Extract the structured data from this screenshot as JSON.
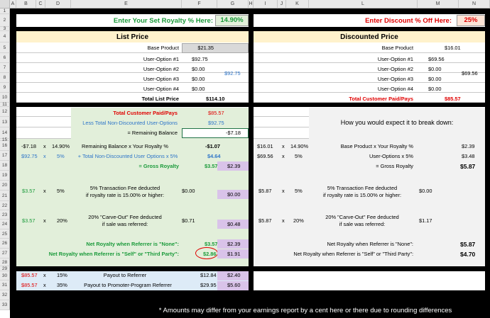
{
  "columns": [
    "A",
    "B",
    "C",
    "D",
    "E",
    "F",
    "G",
    "H",
    "I",
    "J",
    "K",
    "L",
    "M",
    "N"
  ],
  "rows": [
    "1",
    "2",
    "3",
    "4",
    "5",
    "6",
    "7",
    "8",
    "9",
    "10",
    "11",
    "12",
    "13",
    "14",
    "15",
    "16",
    "17",
    "18",
    "19",
    "20",
    "21",
    "22",
    "23",
    "24",
    "25",
    "26",
    "27",
    "28",
    "29",
    "30",
    "31",
    "32",
    "33"
  ],
  "royalty": {
    "label": "Enter Your Set Royalty % Here:",
    "value": "14.90%"
  },
  "discount": {
    "label": "Enter Discount % Off Here:",
    "value": "25%"
  },
  "list_price": {
    "title": "List Price",
    "base_label": "Base Product",
    "base_value": "$21.35",
    "options": [
      {
        "label": "User-Option #1",
        "value": "$92.75"
      },
      {
        "label": "User-Option #2",
        "value": "$0.00"
      },
      {
        "label": "User-Option #3",
        "value": "$0.00"
      },
      {
        "label": "User-Option #4",
        "value": "$0.00"
      }
    ],
    "options_total": "$92.75",
    "total_label": "Total List Price",
    "total_value": "$114.10"
  },
  "discounted_price": {
    "title": "Discounted Price",
    "base_label": "Base Product",
    "base_value": "$16.01",
    "options": [
      {
        "label": "User-Option #1",
        "value": "$69.56"
      },
      {
        "label": "User-Option #2",
        "value": "$0.00"
      },
      {
        "label": "User-Option #3",
        "value": "$0.00"
      },
      {
        "label": "User-Option #4",
        "value": "$0.00"
      }
    ],
    "options_total": "$69.56",
    "total_label": "Total Customer Paid/Pays",
    "total_value": "$85.57"
  },
  "left_calc": {
    "paid_label": "Total Customer Paid/Pays",
    "paid_value": "$85.57",
    "less_label": "Less Total Non-Discounted User-Options",
    "less_value": "$92.75",
    "remaining_label": "= Remaining Balance",
    "remaining_value": "-$7.18",
    "r16": {
      "b": "-$7.18",
      "x": "x",
      "d": "14.90%",
      "label": "Remaining Balance  x Your Royalty %",
      "value": "-$1.07"
    },
    "r17": {
      "b": "$92.75",
      "x": "x",
      "d": "5%",
      "label": "+ Total Non-Discounted User Options x 5%",
      "value": "$4.64"
    },
    "r18": {
      "label": "= Gross Royalty",
      "value": "$3.57",
      "g": "$2.39"
    },
    "r20": {
      "line1": "5% Transaction Fee deducted",
      "line2": "if royalty rate is 15.00% or higher:",
      "b": "$3.57",
      "x": "x",
      "d": "5%",
      "value": "$0.00",
      "g": "$0.00"
    },
    "r23": {
      "line1": "20% \"Carve-Out\" Fee deducted",
      "line2": "if sale was referred:",
      "b": "$3.57",
      "x": "x",
      "d": "20%",
      "value": "$0.71",
      "g": "$0.48"
    },
    "r26": {
      "label": "Net Royalty when Referrer is \"None\":",
      "value": "$3.57",
      "g": "$2.39"
    },
    "r27": {
      "label": "Net Royalty when Referrer is \"Self\" or \"Third Party\":",
      "value": "$2.86",
      "g": "$1.91"
    },
    "r29": {
      "b": "$85.57",
      "x": "x",
      "d": "15%",
      "label": "Payout to Referrer",
      "value": "$12.84",
      "g": "$2.40"
    },
    "r30": {
      "b": "$85.57",
      "x": "x",
      "d": "35%",
      "label": "Payout to Promoter-Program Referrer",
      "value": "$29.95",
      "g": "$5.60"
    }
  },
  "right_calc": {
    "expect_label": "How you would expect it to break down:",
    "r16": {
      "i": "$16.01",
      "x": "x",
      "k": "14.90%",
      "label": "Base Product x Your Royalty %",
      "value": "$2.39"
    },
    "r17": {
      "i": "$69.56",
      "x": "x",
      "k": "5%",
      "label": "User-Options x 5%",
      "value": "$3.48"
    },
    "r18": {
      "label": "= Gross Royalty",
      "value": "$5.87"
    },
    "r20": {
      "line1": "5% Transaction Fee deducted",
      "line2": "if royalty rate is 15.00% or higher:",
      "i": "$5.87",
      "x": "x",
      "k": "5%",
      "value": "$0.00"
    },
    "r23": {
      "line1": "20% \"Carve-Out\" Fee deducted",
      "line2": "if sale was referred:",
      "i": "$5.87",
      "x": "x",
      "k": "20%",
      "value": "$1.17"
    },
    "r26": {
      "label": "Net Royalty when Referrer is \"None\":",
      "value": "$5.87"
    },
    "r27": {
      "label": "Net Royalty when Referrer is \"Self\" or \"Third Party\":",
      "value": "$4.70"
    }
  },
  "footnote": "* Amounts may differ from your earnings report by a cent here or there due to rounding differences",
  "colors": {
    "green_bg": "#e2efda",
    "blue_bg": "#ddebf7",
    "purple": "#d9c3e9",
    "gray_bg": "#f2f2f2",
    "gold": "#fff2cc",
    "red": "#e00000",
    "green": "#1a9a3a",
    "blue": "#2e75c8",
    "circle": "#e00000"
  }
}
